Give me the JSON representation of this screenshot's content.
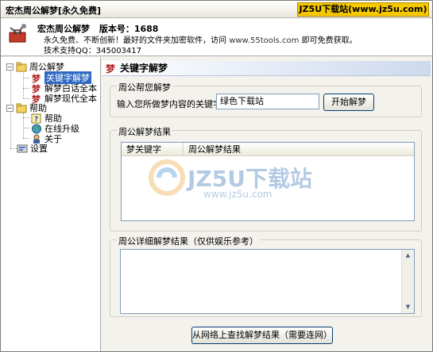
{
  "window": {
    "title": "宏杰周公解梦[永久免费]",
    "brand_badge": "JZ5U下载站(www.jz5u.com)"
  },
  "header": {
    "app_name": "宏杰周公解梦",
    "version_label": "版本号：1688",
    "slogan_prefix": "永久免费、不断创新！最好的文件夹加密软件，访问",
    "slogan_url": "www.55tools.com",
    "slogan_suffix": "即可免费获取。",
    "support": "技术支持QQ：345003417",
    "app_icon": "toolbox-icon"
  },
  "sidebar": {
    "groups": [
      {
        "label": "周公解梦",
        "icon": "folder-icon",
        "expanded": true,
        "children": [
          {
            "label": "关键字解梦",
            "icon": "dream-icon",
            "selected": true
          },
          {
            "label": "解梦白话全本",
            "icon": "dream-icon",
            "selected": false
          },
          {
            "label": "解梦现代全本",
            "icon": "dream-icon",
            "selected": false
          }
        ]
      },
      {
        "label": "帮助",
        "icon": "folder-icon",
        "expanded": true,
        "children": [
          {
            "label": "帮助",
            "icon": "help-icon"
          },
          {
            "label": "在线升级",
            "icon": "globe-icon"
          },
          {
            "label": "关于",
            "icon": "person-icon"
          }
        ]
      },
      {
        "label": "设置",
        "icon": "settings-icon",
        "expanded": false,
        "children": []
      }
    ]
  },
  "main": {
    "title": "关键字解梦",
    "ask_group": {
      "title": "周公帮您解梦",
      "prompt": "输入您所做梦内容的关键字：",
      "input_value": "绿色下载站",
      "button": "开始解梦"
    },
    "results_group": {
      "title": "周公解梦结果",
      "columns": [
        "梦关键字",
        "周公解梦结果"
      ],
      "rows": []
    },
    "detail_group": {
      "title": "周公详细解梦结果（仅供娱乐参考）",
      "content": ""
    },
    "search_online_button": "从网络上查找解梦结果（需要连网）"
  },
  "watermark": {
    "text": "JZ5U下载站",
    "url": "www.jz5u.com"
  },
  "colors": {
    "selection": "#316ac5",
    "brand_badge": "#f6c800",
    "header_gradient_end": "#cdd9ee"
  }
}
